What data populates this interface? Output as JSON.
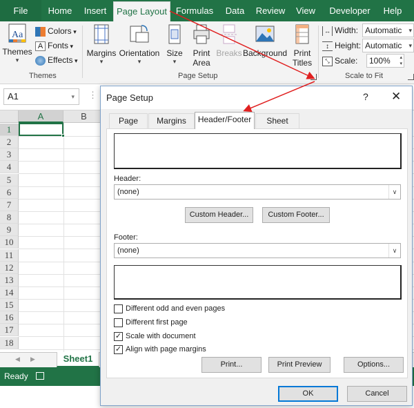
{
  "ribbon_tabs": [
    {
      "label": "File"
    },
    {
      "label": "Home"
    },
    {
      "label": "Insert"
    },
    {
      "label": "Page Layout"
    },
    {
      "label": "Formulas"
    },
    {
      "label": "Data"
    },
    {
      "label": "Review"
    },
    {
      "label": "View"
    },
    {
      "label": "Developer"
    },
    {
      "label": "Help"
    }
  ],
  "ribbon": {
    "themes": {
      "themes_label": "Themes",
      "colors_label": "Colors",
      "fonts_label": "Fonts",
      "effects_label": "Effects",
      "group_label": "Themes"
    },
    "page_setup": {
      "margins_label": "Margins",
      "orientation_label": "Orientation",
      "size_label": "Size",
      "print_area_label_1": "Print",
      "print_area_label_2": "Area",
      "breaks_label": "Breaks",
      "background_label": "Background",
      "print_titles_label_1": "Print",
      "print_titles_label_2": "Titles",
      "group_label": "Page Setup"
    },
    "scale_to_fit": {
      "width_label": "Width:",
      "width_value": "Automatic",
      "height_label": "Height:",
      "height_value": "Automatic",
      "scale_label": "Scale:",
      "scale_value": "100%",
      "group_label": "Scale to Fit"
    }
  },
  "formula_bar": {
    "name_box": "A1"
  },
  "grid": {
    "columns": [
      "A",
      "B"
    ],
    "rows": [
      "1",
      "2",
      "3",
      "4",
      "5",
      "6",
      "7",
      "8",
      "9",
      "10",
      "11",
      "12",
      "13",
      "14",
      "15",
      "16",
      "17",
      "18"
    ]
  },
  "sheet_tabs": {
    "active": "Sheet1"
  },
  "status_bar": {
    "status": "Ready"
  },
  "dialog": {
    "title": "Page Setup",
    "help_glyph": "?",
    "close_glyph": "✕",
    "tabs": [
      {
        "label": "Page"
      },
      {
        "label": "Margins"
      },
      {
        "label": "Header/Footer"
      },
      {
        "label": "Sheet"
      }
    ],
    "header_label": "Header:",
    "header_value": "(none)",
    "custom_header_label": "Custom Header...",
    "custom_footer_label": "Custom Footer...",
    "footer_label": "Footer:",
    "footer_value": "(none)",
    "checkboxes": [
      {
        "label": "Different odd and even pages",
        "checked": false
      },
      {
        "label": "Different first page",
        "checked": false
      },
      {
        "label": "Scale with document",
        "checked": true
      },
      {
        "label": "Align with page margins",
        "checked": true
      }
    ],
    "print_label": "Print...",
    "print_preview_label": "Print Preview",
    "options_label": "Options...",
    "ok_label": "OK",
    "cancel_label": "Cancel"
  },
  "colors": {
    "excel_green": "#217346",
    "annotation_arrow": "#e02020"
  }
}
